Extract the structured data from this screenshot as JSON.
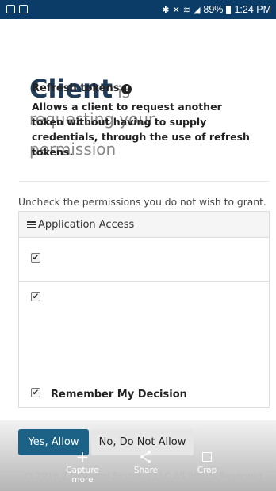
{
  "status_bar": {
    "right_text": "89%",
    "time": "1:24 PM",
    "battery": "89%"
  },
  "title": {
    "client": "Client",
    "is": "is",
    "line2": "requesting your",
    "line3": "permission"
  },
  "instructions": "Uncheck the permissions you do not wish to grant.",
  "panel": {
    "header": "Application Access",
    "refresh_title": "Refresh tokens",
    "refresh_desc": "Allows a client to request another token without having to supply credentials, through the use of refresh tokens."
  },
  "remember": "Remember My Decision",
  "buttons": {
    "allow": "Yes, Allow",
    "deny": "No, Do Not Allow"
  },
  "footer": "© 2016 ZT Control Systems LLC All Rights Reserved.",
  "overlay": {
    "capture": "Capture",
    "capture_more": "more",
    "share": "Share",
    "crop": "Crop"
  }
}
